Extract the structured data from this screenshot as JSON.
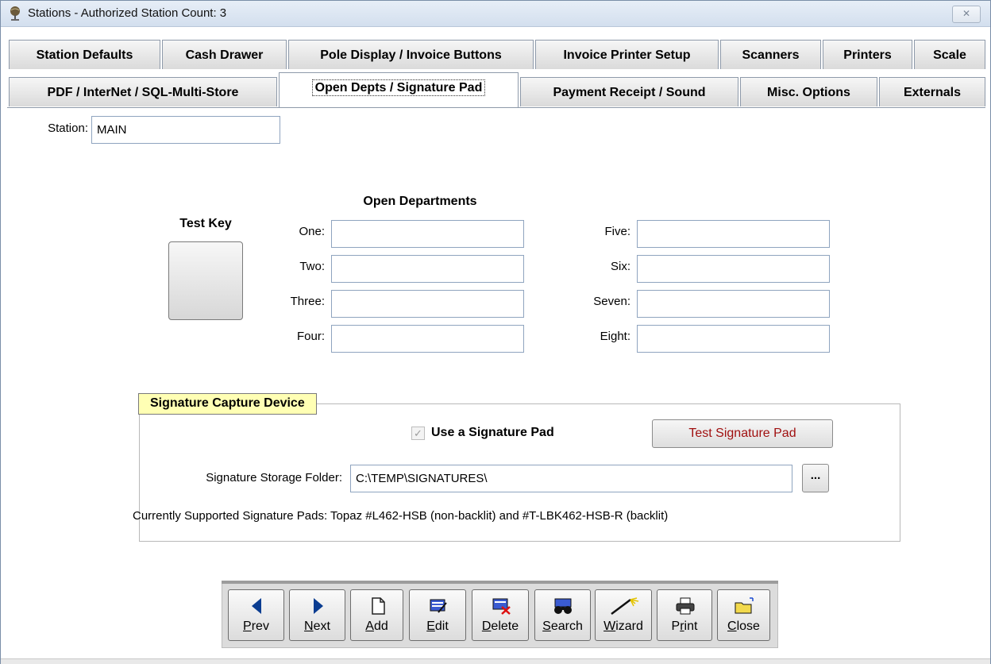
{
  "window": {
    "title": "Stations - Authorized Station Count: 3",
    "close_glyph": "✕"
  },
  "tabs_row1": [
    {
      "label": "Station Defaults"
    },
    {
      "label": "Cash Drawer"
    },
    {
      "label": "Pole Display / Invoice Buttons"
    },
    {
      "label": "Invoice Printer Setup"
    },
    {
      "label": "Scanners"
    },
    {
      "label": "Printers"
    },
    {
      "label": "Scale"
    }
  ],
  "tabs_row2": [
    {
      "label": "PDF / InterNet / SQL-Multi-Store"
    },
    {
      "label": "Open Depts / Signature Pad",
      "active": true
    },
    {
      "label": "Payment Receipt / Sound"
    },
    {
      "label": "Misc. Options"
    },
    {
      "label": "Externals"
    }
  ],
  "station": {
    "label": "Station:",
    "value": "MAIN"
  },
  "test_key": {
    "label": "Test Key"
  },
  "open_departments": {
    "heading": "Open Departments",
    "left": [
      {
        "label": "One:",
        "value": ""
      },
      {
        "label": "Two:",
        "value": ""
      },
      {
        "label": "Three:",
        "value": ""
      },
      {
        "label": "Four:",
        "value": ""
      }
    ],
    "right": [
      {
        "label": "Five:",
        "value": ""
      },
      {
        "label": "Six:",
        "value": ""
      },
      {
        "label": "Seven:",
        "value": ""
      },
      {
        "label": "Eight:",
        "value": ""
      }
    ]
  },
  "signature": {
    "group_title": "Signature Capture Device",
    "use_pad_label": "Use a Signature Pad",
    "use_pad_checked": true,
    "check_glyph": "✓",
    "test_button": "Test Signature Pad",
    "folder_label": "Signature Storage Folder:",
    "folder_value": "C:\\TEMP\\SIGNATURES\\",
    "browse_label": "...",
    "supported_text": "Currently Supported Signature Pads: Topaz  #L462-HSB (non-backlit) and  #T-LBK462-HSB-R (backlit)"
  },
  "toolbar": {
    "buttons": [
      {
        "u": "P",
        "rest": "rev",
        "icon": "prev-arrow-icon"
      },
      {
        "u": "N",
        "rest": "ext",
        "icon": "next-arrow-icon"
      },
      {
        "u": "A",
        "rest": "dd",
        "icon": "new-document-icon"
      },
      {
        "u": "E",
        "rest": "dit",
        "icon": "edit-icon"
      },
      {
        "u": "D",
        "rest": "elete",
        "icon": "delete-icon"
      },
      {
        "u": "S",
        "rest": "earch",
        "icon": "binoculars-icon"
      },
      {
        "u": "W",
        "rest": "izard",
        "icon": "magic-wand-icon"
      },
      {
        "pre": "P",
        "u": "r",
        "rest": "int",
        "icon": "printer-icon"
      },
      {
        "u": "C",
        "rest": "lose",
        "icon": "folder-close-icon"
      }
    ]
  }
}
